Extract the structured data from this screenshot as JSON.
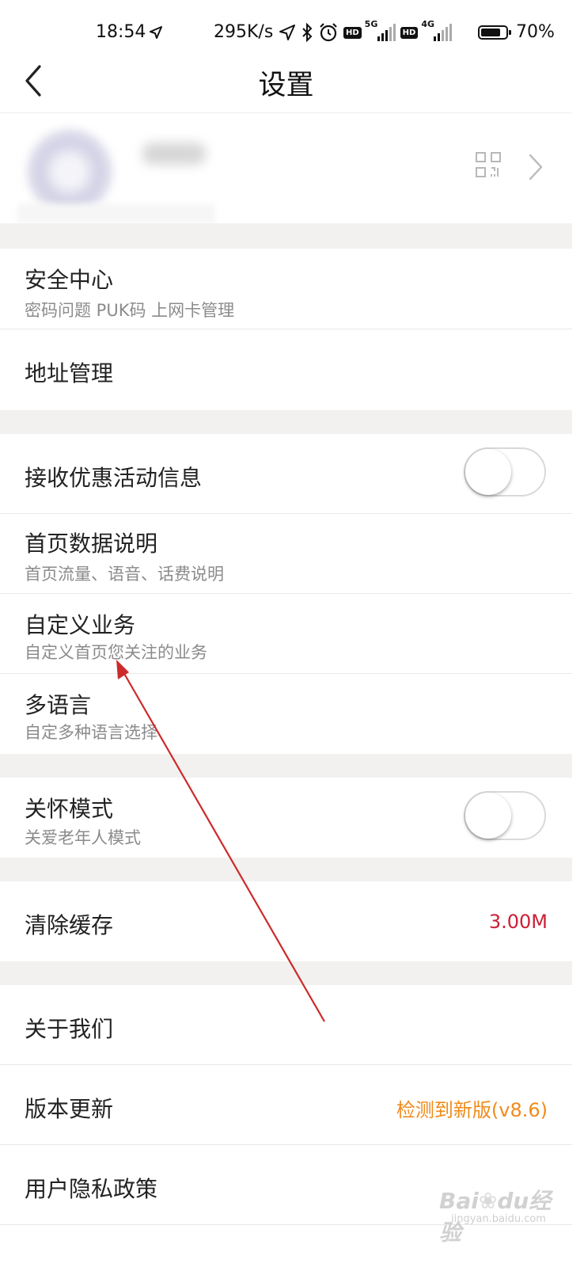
{
  "status_bar": {
    "time": "18:54",
    "speed": "295K/s",
    "net1": "5G",
    "net2": "4G",
    "hd": "HD",
    "battery": "70%"
  },
  "header": {
    "title": "设置",
    "icons": [
      "back-arrow-icon"
    ]
  },
  "profile": {
    "icons": [
      "qr-code-icon",
      "chevron-right-icon"
    ]
  },
  "groups": {
    "security": {
      "title": "安全中心",
      "subtitle": "密码问题 PUK码 上网卡管理"
    },
    "address": {
      "title": "地址管理"
    },
    "promo": {
      "title": "接收优惠活动信息",
      "toggle_on": false
    },
    "home_data": {
      "title": "首页数据说明",
      "subtitle": "首页流量、语音、话费说明"
    },
    "custom": {
      "title": "自定义业务",
      "subtitle": "自定义首页您关注的业务"
    },
    "language": {
      "title": "多语言",
      "subtitle": "自定多种语言选择"
    },
    "care": {
      "title": "关怀模式",
      "subtitle": "关爱老年人模式",
      "toggle_on": false
    },
    "cache": {
      "title": "清除缓存",
      "value": "3.00M"
    },
    "about": {
      "title": "关于我们"
    },
    "update": {
      "title": "版本更新",
      "value": "检测到新版(v8.6)"
    },
    "privacy": {
      "title": "用户隐私政策"
    }
  },
  "colors": {
    "accent_red": "#cc1f35",
    "accent_orange": "#ef8b1a",
    "gap": "#f2f1f0",
    "annotation_arrow": "#cc2b2b"
  },
  "watermark": {
    "brand": "Bai",
    "brand2": "du",
    "brand_cn": "经验",
    "sub": "jingyan.baidu.com"
  }
}
